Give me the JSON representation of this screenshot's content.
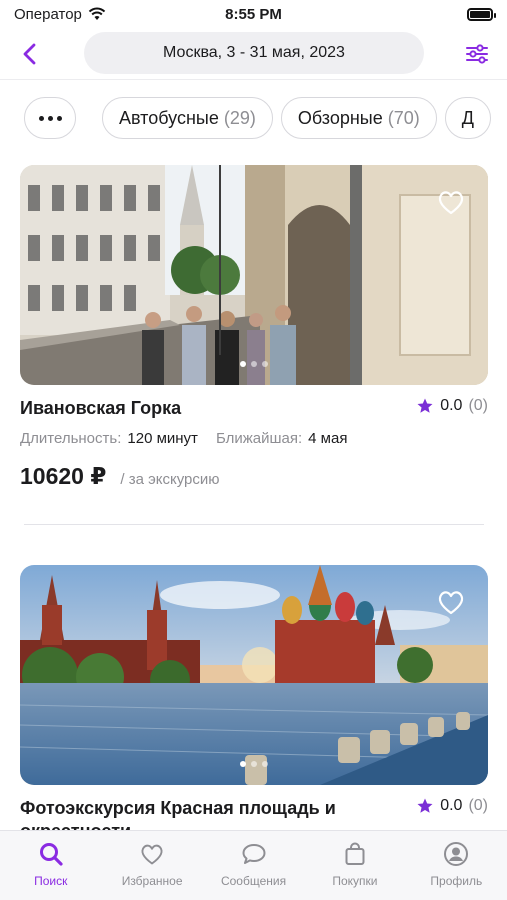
{
  "status_bar": {
    "carrier": "Оператор",
    "time": "8:55 PM"
  },
  "nav": {
    "title": "Москва, 3 - 31 мая, 2023"
  },
  "chips": [
    {
      "label": "Автобусные",
      "count": "(29)"
    },
    {
      "label": "Обзорные",
      "count": "(70)"
    },
    {
      "label": "Д",
      "count": ""
    }
  ],
  "cards": [
    {
      "title": "Ивановская Горка",
      "rating": "0.0",
      "rating_count": "(0)",
      "duration_label": "Длительность:",
      "duration": "120 минут",
      "nearest_label": "Ближайшая:",
      "nearest": "4 мая",
      "price": "10620 ₽",
      "per": "/ за экскурсию"
    },
    {
      "title": "Фотоэкскурсия Красная площадь и окрестности",
      "rating": "0.0",
      "rating_count": "(0)"
    }
  ],
  "tabs": [
    {
      "label": "Поиск",
      "icon": "search-icon"
    },
    {
      "label": "Избранное",
      "icon": "heart-icon"
    },
    {
      "label": "Сообщения",
      "icon": "chat-bubble-icon"
    },
    {
      "label": "Покупки",
      "icon": "shopping-bag-icon"
    },
    {
      "label": "Профиль",
      "icon": "person-circle-icon"
    }
  ],
  "colors": {
    "accent": "#8a2be2",
    "star": "#7b2fd6",
    "muted": "#8e8e93"
  }
}
